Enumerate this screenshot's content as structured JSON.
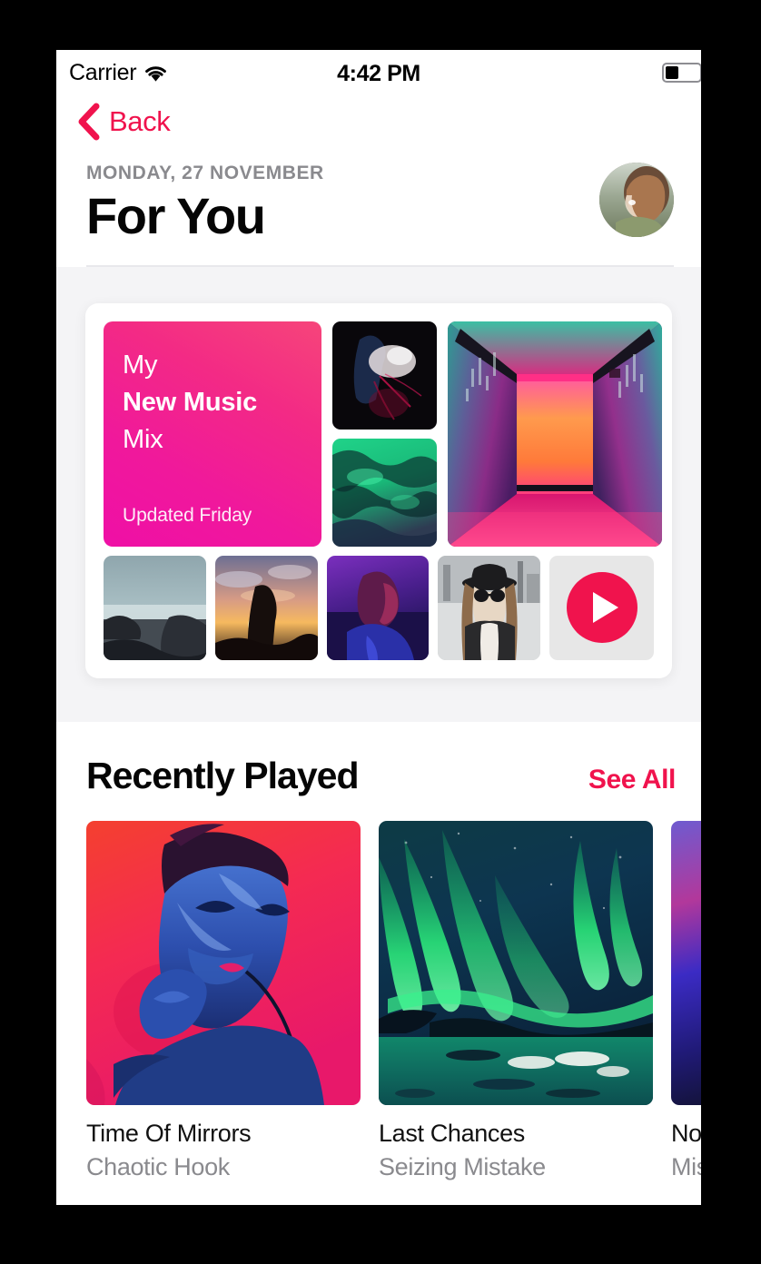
{
  "status_bar": {
    "carrier": "Carrier",
    "wifi_icon": "wifi-icon",
    "time": "4:42 PM",
    "battery_icon": "battery-icon",
    "battery_level_pct": 40
  },
  "nav": {
    "back_label": "Back",
    "back_icon": "chevron-left-icon",
    "accent_color": "#F0134D"
  },
  "header": {
    "date": "MONDAY, 27 NOVEMBER",
    "title": "For You",
    "avatar_name": "user-avatar"
  },
  "mix_card": {
    "tile": {
      "line1": "My",
      "line2": "New Music",
      "line3": "Mix",
      "updated": "Updated Friday",
      "gradient_from": "#EF0FA6",
      "gradient_to": "#F6457A"
    },
    "play_button_label": "play-button",
    "play_color": "#F0134D",
    "tiles": [
      {
        "name": "mosaic-tile-smoke",
        "alt": "dark figure with red smoke"
      },
      {
        "name": "mosaic-tile-green-texture",
        "alt": "green marbled texture"
      },
      {
        "name": "mosaic-tile-neon-corridor",
        "alt": "neon lit corridor"
      },
      {
        "name": "mosaic-thumb-seascape",
        "alt": "grey rocky seascape"
      },
      {
        "name": "mosaic-thumb-sunset",
        "alt": "person at sunset"
      },
      {
        "name": "mosaic-thumb-purple-portrait",
        "alt": "portrait in purple light"
      },
      {
        "name": "mosaic-thumb-street-hat",
        "alt": "woman in hat and sunglasses"
      }
    ]
  },
  "recently_played": {
    "title": "Recently Played",
    "see_all_label": "See All",
    "items": [
      {
        "track": "Time Of Mirrors",
        "artist": "Chaotic Hook",
        "art_name": "album-art-time-of-mirrors"
      },
      {
        "track": "Last Chances",
        "artist": "Seizing Mistake",
        "art_name": "album-art-last-chances"
      },
      {
        "track": "No T",
        "artist": "Misc",
        "art_name": "album-art-third-partial"
      }
    ]
  }
}
